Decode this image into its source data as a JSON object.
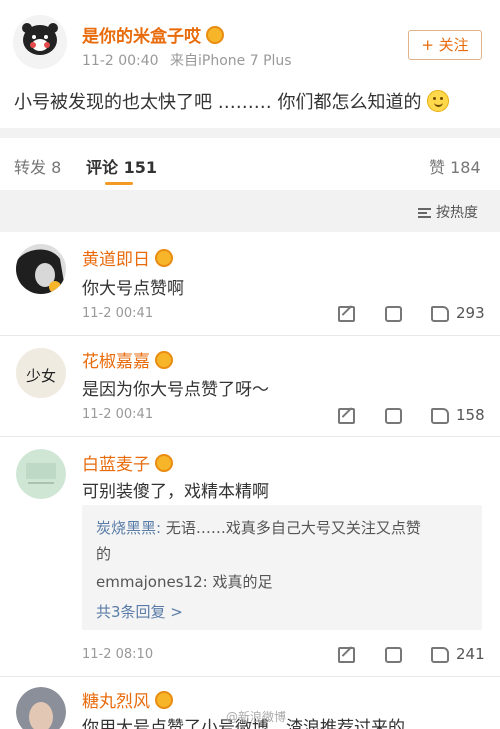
{
  "post": {
    "username": "是你的米盒子哎",
    "time": "11-2 00:40",
    "source": "来自iPhone 7 Plus",
    "follow_label": "+ 关注",
    "text": "小号被发现的也太快了吧 ……… 你们都怎么知道的"
  },
  "tabs": {
    "repost": "转发 8",
    "comment": "评论 151",
    "like": "赞 184"
  },
  "sort_label": "按热度",
  "comments": [
    {
      "username": "黄道即日",
      "text": "你大号点赞啊",
      "time": "11-2 00:41",
      "likes": "293"
    },
    {
      "username": "花椒嘉嘉",
      "text": "是因为你大号点赞了呀～",
      "time": "11-2 00:41",
      "likes": "158",
      "avatar_text": "少女"
    },
    {
      "username": "白蓝麦子",
      "text": "可别装傻了，戏精本精啊",
      "time": "11-2 08:10",
      "likes": "241"
    },
    {
      "username": "糖丸烈风",
      "text": "你用大号点赞了小号微博，渣浪推荐过来的"
    }
  ],
  "replies": [
    {
      "name": "炭烧黑黑:",
      "text": " 无语……戏真多自己大号又关注又点赞"
    },
    {
      "name": "",
      "text": "的"
    },
    {
      "name": "emmajones12:",
      "text": " 戏真的足"
    }
  ],
  "reply_more": "共3条回复 >",
  "watermark": "@新浪微博"
}
